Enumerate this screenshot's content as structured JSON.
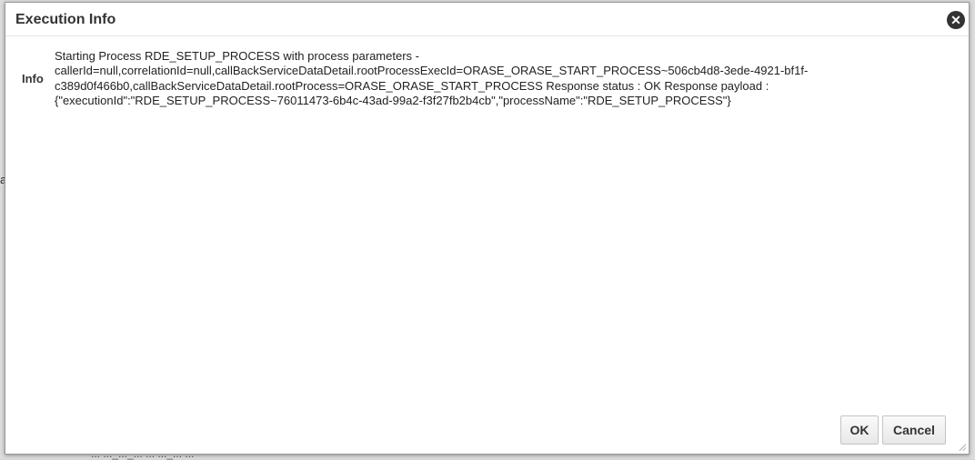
{
  "background": {
    "left_fragment": "a",
    "bottom_fragment": "... ..._..._... ... ..._... ..."
  },
  "dialog": {
    "title": "Execution Info",
    "close_icon": "close-circle-icon",
    "info_label": "Info",
    "message_lines": [
      "Starting Process RDE_SETUP_PROCESS with process parameters -",
      "callerId=null,correlationId=null,callBackServiceDataDetail.rootProcessExecId=ORASE_ORASE_START_PROCESS~506cb4d8-3ede-4921-bf1f-",
      "c389d0f466b0,callBackServiceDataDetail.rootProcess=ORASE_ORASE_START_PROCESS Response status : OK Response payload :",
      "{\"executionId\":\"RDE_SETUP_PROCESS~76011473-6b4c-43ad-99a2-f3f27fb2b4cb\",\"processName\":\"RDE_SETUP_PROCESS\"}"
    ],
    "ok_label": "OK",
    "cancel_label": "Cancel"
  }
}
